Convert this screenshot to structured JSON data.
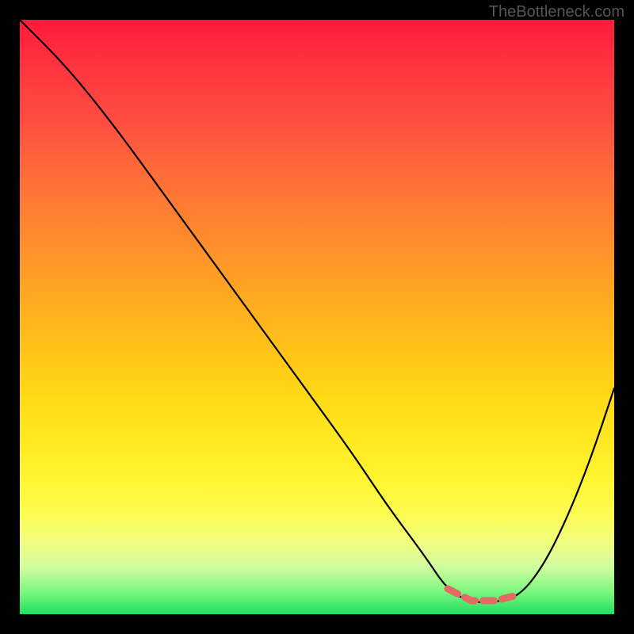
{
  "watermark": "TheBottleneck.com",
  "chart_data": {
    "type": "line",
    "title": "",
    "xlabel": "",
    "ylabel": "",
    "xlim": [
      0,
      100
    ],
    "ylim": [
      0,
      100
    ],
    "note": "Unlabeled bottleneck curve over a performance-gradient background. The black curve represents bottleneck level (high = top of plot). It descends steeply from top-left, flattens near zero around x≈72–82 (marked with a red highlighted segment), then rises toward the right edge. Axis values are not shown in the image; x and y are normalized 0–100.",
    "series": [
      {
        "name": "bottleneck_curve",
        "x": [
          0,
          8,
          16,
          24,
          32,
          40,
          48,
          56,
          62,
          68,
          72,
          76,
          80,
          84,
          88,
          92,
          96,
          100
        ],
        "y": [
          100,
          92,
          82,
          71,
          60,
          49,
          38,
          27,
          18,
          10,
          4,
          2,
          2,
          3,
          8,
          16,
          26,
          38
        ]
      }
    ],
    "highlight_region": {
      "x_start": 70,
      "x_end": 84
    },
    "gradient_meaning": "background color gradient from red (top, high bottleneck) through orange/yellow to green (bottom, optimal)"
  }
}
